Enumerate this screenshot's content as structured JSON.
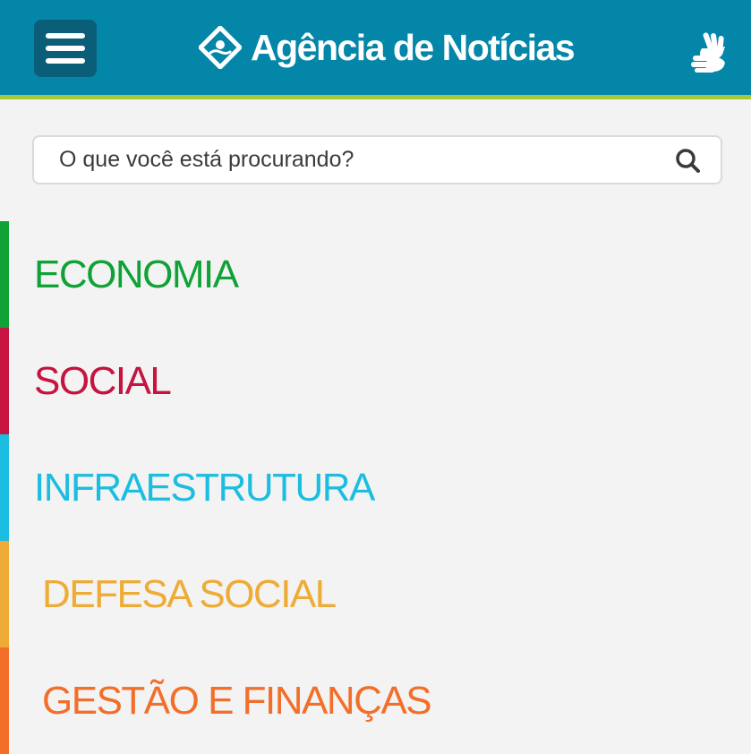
{
  "header": {
    "title": "Agência de Notícias",
    "icons": {
      "menu": "hamburger-menu-icon",
      "logo": "diamond-logo-icon",
      "accessibility": "sign-language-icon"
    },
    "colors": {
      "background": "#0386a8",
      "accent_line": "#a6c83a",
      "menu_button": "#0b5e78"
    }
  },
  "search": {
    "placeholder": "O que você está procurando?",
    "value": "",
    "icon": "search-icon"
  },
  "categories": [
    {
      "label": "ECONOMIA",
      "color": "#10a236"
    },
    {
      "label": "SOCIAL",
      "color": "#c5143f"
    },
    {
      "label": "INFRAESTRUTURA",
      "color": "#1bbde0"
    },
    {
      "label": "DEFESA SOCIAL",
      "color": "#eeab36"
    },
    {
      "label": "GESTÃO E FINANÇAS",
      "color": "#f26f2a"
    }
  ]
}
